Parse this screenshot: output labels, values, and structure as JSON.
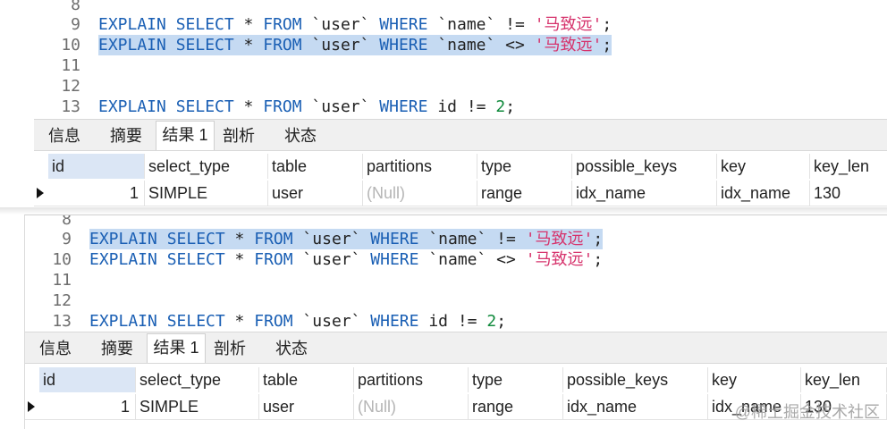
{
  "panel1": {
    "lines": [
      {
        "n": "8",
        "segs": []
      },
      {
        "n": "9",
        "segs": [
          [
            "kw",
            "EXPLAIN SELECT"
          ],
          [
            "t",
            " * "
          ],
          [
            "kw",
            "FROM"
          ],
          [
            "t",
            " `user` "
          ],
          [
            "kw",
            "WHERE"
          ],
          [
            "t",
            " `name` != "
          ],
          [
            "str",
            "'马致远'"
          ],
          [
            "t",
            ";"
          ]
        ]
      },
      {
        "n": "10",
        "segs": [
          [
            "kw",
            "EXPLAIN SELECT"
          ],
          [
            "t",
            " * "
          ],
          [
            "kw",
            "FROM"
          ],
          [
            "t",
            " `user` "
          ],
          [
            "kw",
            "WHERE"
          ],
          [
            "t",
            " `name` <> "
          ],
          [
            "str",
            "'马致远'"
          ],
          [
            "t",
            ";"
          ]
        ]
      },
      {
        "n": "11",
        "segs": []
      },
      {
        "n": "12",
        "segs": []
      },
      {
        "n": "13",
        "segs": [
          [
            "kw",
            "EXPLAIN SELECT"
          ],
          [
            "t",
            " * "
          ],
          [
            "kw",
            "FROM"
          ],
          [
            "t",
            " `user` "
          ],
          [
            "kw",
            "WHERE"
          ],
          [
            "t",
            " id != "
          ],
          [
            "num",
            "2"
          ],
          [
            "t",
            ";"
          ]
        ]
      }
    ],
    "highlight_line": 2
  },
  "panel2": {
    "lines": [
      {
        "n": "8",
        "segs": []
      },
      {
        "n": "9",
        "segs": [
          [
            "kw",
            "EXPLAIN SELECT"
          ],
          [
            "t",
            " * "
          ],
          [
            "kw",
            "FROM"
          ],
          [
            "t",
            " `user` "
          ],
          [
            "kw",
            "WHERE"
          ],
          [
            "t",
            " `name` != "
          ],
          [
            "str",
            "'马致远'"
          ],
          [
            "t",
            ";"
          ]
        ]
      },
      {
        "n": "10",
        "segs": [
          [
            "kw",
            "EXPLAIN SELECT"
          ],
          [
            "t",
            " * "
          ],
          [
            "kw",
            "FROM"
          ],
          [
            "t",
            " `user` "
          ],
          [
            "kw",
            "WHERE"
          ],
          [
            "t",
            " `name` <> "
          ],
          [
            "str",
            "'马致远'"
          ],
          [
            "t",
            ";"
          ]
        ]
      },
      {
        "n": "11",
        "segs": []
      },
      {
        "n": "12",
        "segs": []
      },
      {
        "n": "13",
        "segs": [
          [
            "kw",
            "EXPLAIN SELECT"
          ],
          [
            "t",
            " * "
          ],
          [
            "kw",
            "FROM"
          ],
          [
            "t",
            " `user` "
          ],
          [
            "kw",
            "WHERE"
          ],
          [
            "t",
            " id != "
          ],
          [
            "num",
            "2"
          ],
          [
            "t",
            ";"
          ]
        ]
      }
    ],
    "highlight_line": 1
  },
  "tabs": [
    "信息",
    "摘要",
    "结果 1",
    "剖析",
    "状态"
  ],
  "active_tab": 2,
  "result": {
    "headers": [
      "id",
      "select_type",
      "table",
      "partitions",
      "type",
      "possible_keys",
      "key",
      "key_len"
    ],
    "row": [
      "1",
      "SIMPLE",
      "user",
      "(Null)",
      "range",
      "idx_name",
      "idx_name",
      "130"
    ]
  },
  "watermark": "@稀土掘金技术社区",
  "colors": {
    "keyword": "#1a5fb4",
    "string": "#d6336c",
    "number": "#108a3c",
    "selection": "#c5daf2"
  }
}
